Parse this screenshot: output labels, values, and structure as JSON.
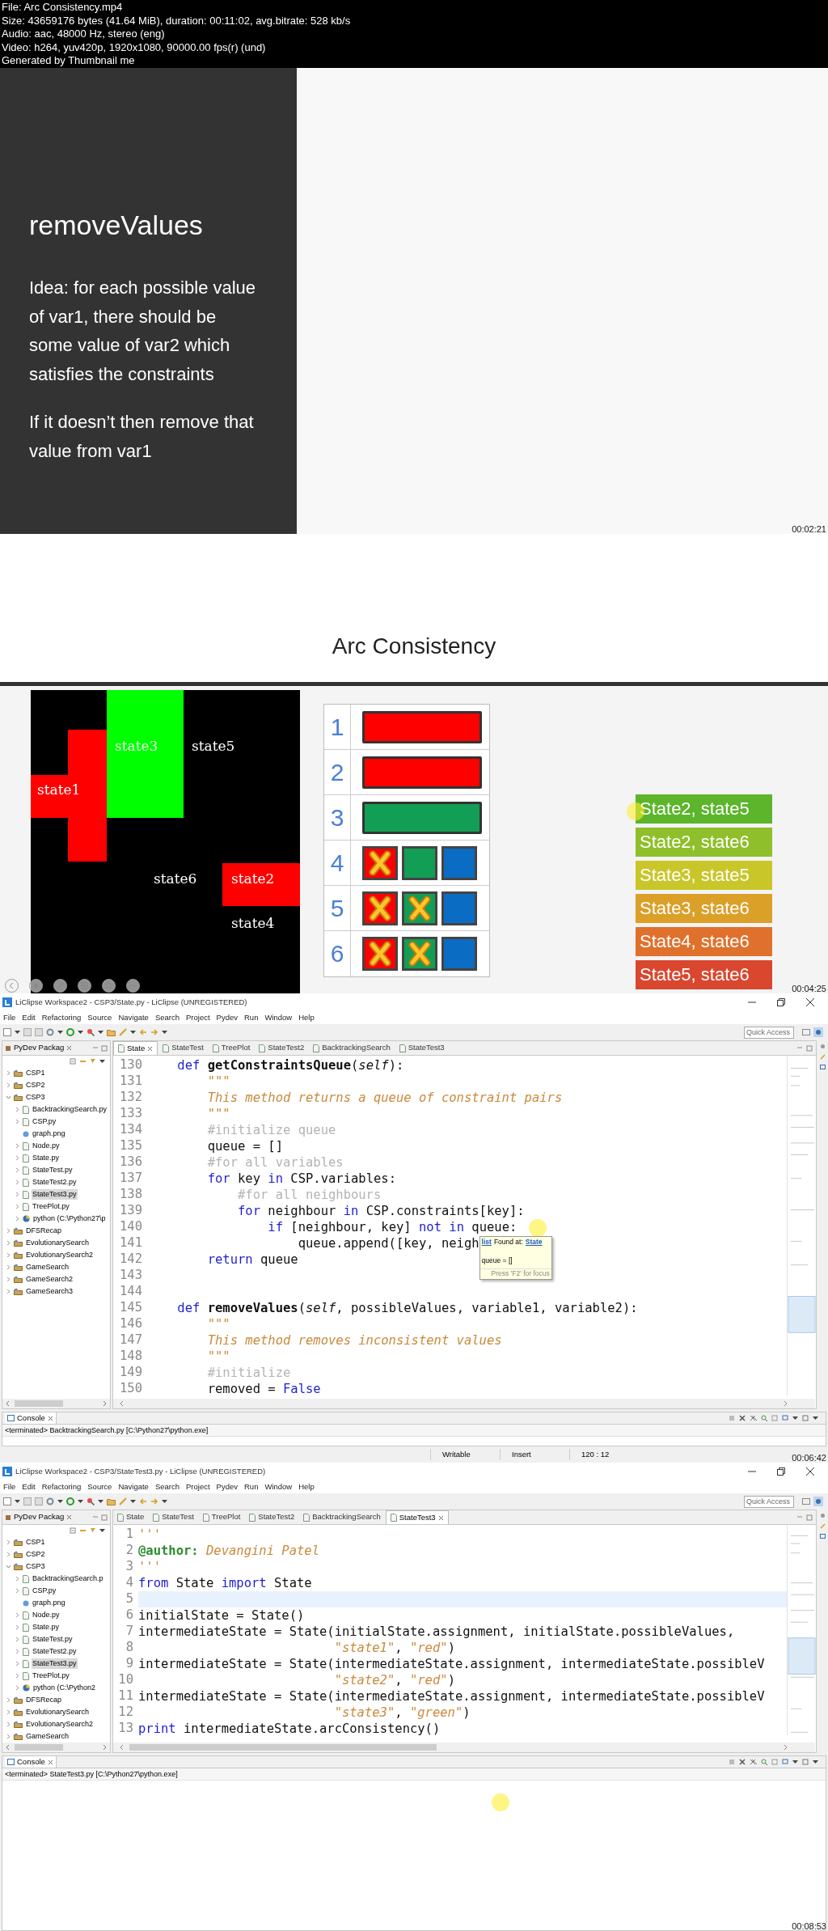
{
  "file_info": [
    "File: Arc Consistency.mp4",
    "Size: 43659176 bytes (41.64 MiB), duration: 00:11:02, avg.bitrate: 528 kb/s",
    "Audio: aac, 48000 Hz, stereo (eng)",
    "Video: h264, yuv420p, 1920x1080, 90000.00 fps(r) (und)",
    "Generated by Thumbnail me"
  ],
  "frames": [
    {
      "kind": "text_slide",
      "title": "removeValues",
      "paragraphs": [
        "Idea: for each possible value of var1, there should be some value of var2 which satisfies the constraints",
        "If it doesn’t then remove that value from var1"
      ],
      "timestamp": "00:02:21"
    },
    {
      "kind": "diagram_slide",
      "title": "Arc Consistency",
      "map": [
        {
          "label": "state3",
          "color": "#00ff00"
        },
        {
          "label": "state5"
        },
        {
          "label": "state1",
          "color": "#ff0000"
        },
        {
          "label": "state6"
        },
        {
          "label": "state2",
          "color": "#ff0000"
        },
        {
          "label": "state4"
        }
      ],
      "table": [
        {
          "number": "1",
          "kind": "bar",
          "color": "#ff0000"
        },
        {
          "number": "2",
          "kind": "bar",
          "color": "#ff0000"
        },
        {
          "number": "3",
          "kind": "bar",
          "color": "#139e55"
        },
        {
          "number": "4",
          "kind": "squares",
          "squares": [
            {
              "color": "#ff0000",
              "crossed": true
            },
            {
              "color": "#139e55",
              "crossed": false
            },
            {
              "color": "#0b6cc4",
              "crossed": false
            }
          ]
        },
        {
          "number": "5",
          "kind": "squares",
          "squares": [
            {
              "color": "#ff0000",
              "crossed": true
            },
            {
              "color": "#139e55",
              "crossed": true
            },
            {
              "color": "#0b6cc4",
              "crossed": false
            }
          ]
        },
        {
          "number": "6",
          "kind": "squares",
          "squares": [
            {
              "color": "#ff0000",
              "crossed": true
            },
            {
              "color": "#139e55",
              "crossed": true
            },
            {
              "color": "#0b6cc4",
              "crossed": false
            }
          ]
        }
      ],
      "pairs": [
        {
          "text": "State2, state5",
          "color": "#5cb52a"
        },
        {
          "text": "State2, state6",
          "color": "#8fbf2a"
        },
        {
          "text": "State3, state5",
          "color": "#c9c62a"
        },
        {
          "text": "State3, state6",
          "color": "#dba028"
        },
        {
          "text": "State4, state6",
          "color": "#e0712c"
        },
        {
          "text": "State5, state6",
          "color": "#d9472f"
        }
      ],
      "timestamp": "00:04:25"
    },
    {
      "kind": "ide",
      "title": "LiClipse Workspace2 - CSP3/State.py - LiClipse (UNREGISTERED)",
      "menu": [
        "File",
        "Edit",
        "Refactoring",
        "Source",
        "Navigate",
        "Search",
        "Project",
        "Pydev",
        "Run",
        "Window",
        "Help"
      ],
      "quick_access": {
        "placeholder": "Quick Access"
      },
      "explorer": {
        "title": "PyDev Packag",
        "tree": [
          {
            "label": "CSP1",
            "kind": "project",
            "expanded": false,
            "selected": false
          },
          {
            "label": "CSP2",
            "kind": "project",
            "expanded": false,
            "selected": false
          },
          {
            "label": "CSP3",
            "kind": "project",
            "expanded": true,
            "selected": false,
            "children": [
              {
                "label": "BacktrackingSearch.py",
                "kind": "file",
                "expanded": false,
                "selected": false
              },
              {
                "label": "CSP.py",
                "kind": "file",
                "expanded": false,
                "selected": false
              },
              {
                "label": "graph.png",
                "kind": "image",
                "selected": false
              },
              {
                "label": "Node.py",
                "kind": "file",
                "expanded": false,
                "selected": false
              },
              {
                "label": "State.py",
                "kind": "file",
                "expanded": false,
                "selected": false
              },
              {
                "label": "StateTest.py",
                "kind": "file",
                "expanded": false,
                "selected": false
              },
              {
                "label": "StateTest2.py",
                "kind": "file",
                "expanded": false,
                "selected": false
              },
              {
                "label": "StateTest3.py",
                "kind": "file",
                "expanded": false,
                "selected": true
              },
              {
                "label": "TreePlot.py",
                "kind": "file",
                "expanded": false,
                "selected": false
              },
              {
                "label": "python (C:\\Python27\\p",
                "kind": "interpreter",
                "expanded": false,
                "selected": false
              }
            ]
          },
          {
            "label": "DFSRecap",
            "kind": "project",
            "expanded": false,
            "selected": false
          },
          {
            "label": "EvolutionarySearch",
            "kind": "project",
            "expanded": false,
            "selected": false
          },
          {
            "label": "EvolutionarySearch2",
            "kind": "project",
            "expanded": false,
            "selected": false
          },
          {
            "label": "GameSearch",
            "kind": "project",
            "expanded": false,
            "selected": false
          },
          {
            "label": "GameSearch2",
            "kind": "project",
            "expanded": false,
            "selected": false
          },
          {
            "label": "GameSearch3",
            "kind": "project",
            "expanded": false,
            "selected": false
          }
        ]
      },
      "tabs": [
        {
          "label": "State",
          "selected": true
        },
        {
          "label": "StateTest",
          "selected": false
        },
        {
          "label": "TreePlot",
          "selected": false
        },
        {
          "label": "StateTest2",
          "selected": false
        },
        {
          "label": "BacktrackingSearch",
          "selected": false
        },
        {
          "label": "StateTest3",
          "selected": false
        }
      ],
      "code": [
        {
          "number": "130",
          "segments": [
            {
              "text": "    def",
              "kind": "keyword"
            },
            {
              "text": " getConstraintsQueue",
              "kind": "name"
            },
            {
              "text": "(",
              "kind": "plain"
            },
            {
              "text": "self",
              "kind": "self"
            },
            {
              "text": "):",
              "kind": "plain"
            }
          ]
        },
        {
          "number": "131",
          "segments": [
            {
              "text": "        \"\"\"",
              "kind": "doc"
            }
          ]
        },
        {
          "number": "132",
          "segments": [
            {
              "text": "        This method returns a queue of constraint pairs",
              "kind": "doc"
            }
          ]
        },
        {
          "number": "133",
          "segments": [
            {
              "text": "        \"\"\"",
              "kind": "doc"
            }
          ]
        },
        {
          "number": "134",
          "segments": [
            {
              "text": "        #initialize queue",
              "kind": "comment"
            }
          ]
        },
        {
          "number": "135",
          "segments": [
            {
              "text": "        queue = []",
              "kind": "plain"
            }
          ]
        },
        {
          "number": "136",
          "segments": [
            {
              "text": "        #for all variables",
              "kind": "comment"
            }
          ]
        },
        {
          "number": "137",
          "segments": [
            {
              "text": "        for",
              "kind": "keyword"
            },
            {
              "text": " key ",
              "kind": "plain"
            },
            {
              "text": "in",
              "kind": "keyword"
            },
            {
              "text": " CSP.variables:",
              "kind": "plain"
            }
          ]
        },
        {
          "number": "138",
          "segments": [
            {
              "text": "            #for all neighbours",
              "kind": "comment"
            }
          ]
        },
        {
          "number": "139",
          "segments": [
            {
              "text": "            for",
              "kind": "keyword"
            },
            {
              "text": " neighbour ",
              "kind": "plain"
            },
            {
              "text": "in",
              "kind": "keyword"
            },
            {
              "text": " CSP.constraints[key]:",
              "kind": "plain"
            }
          ]
        },
        {
          "number": "140",
          "segments": [
            {
              "text": "                if",
              "kind": "keyword"
            },
            {
              "text": " [neighbour, key] ",
              "kind": "plain"
            },
            {
              "text": "not in",
              "kind": "keyword"
            },
            {
              "text": " queue:",
              "kind": "plain"
            }
          ]
        },
        {
          "number": "141",
          "segments": [
            {
              "text": "                    queue.append([key, neigh",
              "kind": "plain"
            }
          ],
          "tooltip": {
            "type_link": "list",
            "label": "Found at:",
            "location_link": "State",
            "code": "queue = []",
            "hint": "Press 'F2' for focus"
          }
        },
        {
          "number": "142",
          "segments": [
            {
              "text": "        return",
              "kind": "keyword"
            },
            {
              "text": " queue",
              "kind": "plain"
            }
          ]
        },
        {
          "number": "143"
        },
        {
          "number": "144"
        },
        {
          "number": "145",
          "segments": [
            {
              "text": "    def",
              "kind": "keyword"
            },
            {
              "text": " removeValues",
              "kind": "name"
            },
            {
              "text": "(",
              "kind": "plain"
            },
            {
              "text": "self",
              "kind": "self"
            },
            {
              "text": ", possibleValues, variable1, variable2):",
              "kind": "plain"
            }
          ]
        },
        {
          "number": "146",
          "segments": [
            {
              "text": "        \"\"\"",
              "kind": "doc"
            }
          ]
        },
        {
          "number": "147",
          "segments": [
            {
              "text": "        This method removes inconsistent values",
              "kind": "doc"
            }
          ]
        },
        {
          "number": "148",
          "segments": [
            {
              "text": "        \"\"\"",
              "kind": "doc"
            }
          ]
        },
        {
          "number": "149",
          "segments": [
            {
              "text": "        #initialize",
              "kind": "comment"
            }
          ]
        },
        {
          "number": "150",
          "segments": [
            {
              "text": "        removed = ",
              "kind": "plain"
            },
            {
              "text": "False",
              "kind": "keyword"
            }
          ]
        }
      ],
      "console": {
        "title": "Console",
        "status": "<terminated> BacktrackingSearch.py [C:\\Python27\\python.exe]"
      },
      "status_bar": [
        "Writable",
        "Insert",
        "120 : 12"
      ],
      "timestamp": "00:06:42"
    },
    {
      "kind": "ide",
      "title": "LiClipse Workspace2 - CSP3/StateTest3.py - LiClipse (UNREGISTERED)",
      "menu": [
        "File",
        "Edit",
        "Refactoring",
        "Source",
        "Navigate",
        "Search",
        "Project",
        "Pydev",
        "Run",
        "Window",
        "Help"
      ],
      "quick_access": {
        "placeholder": "Quick Access"
      },
      "explorer": {
        "title": "PyDev Packag",
        "tree": [
          {
            "label": "CSP1",
            "kind": "project",
            "expanded": false,
            "selected": false
          },
          {
            "label": "CSP2",
            "kind": "project",
            "expanded": false,
            "selected": false
          },
          {
            "label": "CSP3",
            "kind": "project",
            "expanded": true,
            "selected": false,
            "children": [
              {
                "label": "BacktrackingSearch.p",
                "kind": "file",
                "expanded": false,
                "selected": false
              },
              {
                "label": "CSP.py",
                "kind": "file",
                "expanded": false,
                "selected": false
              },
              {
                "label": "graph.png",
                "kind": "image",
                "selected": false
              },
              {
                "label": "Node.py",
                "kind": "file",
                "expanded": false,
                "selected": false
              },
              {
                "label": "State.py",
                "kind": "file",
                "expanded": false,
                "selected": false
              },
              {
                "label": "StateTest.py",
                "kind": "file",
                "expanded": false,
                "selected": false
              },
              {
                "label": "StateTest2.py",
                "kind": "file",
                "expanded": false,
                "selected": false
              },
              {
                "label": "StateTest3.py",
                "kind": "file",
                "expanded": false,
                "selected": true
              },
              {
                "label": "TreePlot.py",
                "kind": "file",
                "expanded": false,
                "selected": false
              },
              {
                "label": "python (C:\\Python2",
                "kind": "interpreter",
                "expanded": false,
                "selected": false
              }
            ]
          },
          {
            "label": "DFSRecap",
            "kind": "project",
            "expanded": false,
            "selected": false
          },
          {
            "label": "EvolutionarySearch",
            "kind": "project",
            "expanded": false,
            "selected": false
          },
          {
            "label": "EvolutionarySearch2",
            "kind": "project",
            "expanded": false,
            "selected": false
          },
          {
            "label": "GameSearch",
            "kind": "project",
            "expanded": false,
            "selected": false
          }
        ]
      },
      "tabs": [
        {
          "label": "State",
          "selected": false
        },
        {
          "label": "StateTest",
          "selected": false
        },
        {
          "label": "TreePlot",
          "selected": false
        },
        {
          "label": "StateTest2",
          "selected": false
        },
        {
          "label": "BacktrackingSearch",
          "selected": false
        },
        {
          "label": "StateTest3",
          "selected": true
        }
      ],
      "code": [
        {
          "number": "1",
          "segments": [
            {
              "text": "'''",
              "kind": "string"
            }
          ]
        },
        {
          "number": "2",
          "segments": [
            {
              "text": "@author:",
              "kind": "decorator"
            },
            {
              "text": " Devangini Patel",
              "kind": "string"
            }
          ]
        },
        {
          "number": "3",
          "segments": [
            {
              "text": "'''",
              "kind": "string"
            }
          ]
        },
        {
          "number": "4",
          "segments": [
            {
              "text": "from",
              "kind": "keyword"
            },
            {
              "text": " State ",
              "kind": "plain"
            },
            {
              "text": "import",
              "kind": "keyword"
            },
            {
              "text": " State",
              "kind": "plain"
            }
          ]
        },
        {
          "number": "5",
          "highlighted": true
        },
        {
          "number": "6",
          "segments": [
            {
              "text": "initialState = State()",
              "kind": "plain"
            }
          ]
        },
        {
          "number": "7",
          "segments": [
            {
              "text": "intermediateState = State(initialState.assignment, initialState.possibleValues,",
              "kind": "plain"
            }
          ]
        },
        {
          "number": "8",
          "segments": [
            {
              "text": "                          \"state1\"",
              "kind": "string"
            },
            {
              "text": ", ",
              "kind": "plain"
            },
            {
              "text": "\"red\"",
              "kind": "string"
            },
            {
              "text": ")",
              "kind": "plain"
            }
          ]
        },
        {
          "number": "9",
          "segments": [
            {
              "text": "intermediateState = State(intermediateState.assignment, intermediateState.possibleV",
              "kind": "plain"
            }
          ]
        },
        {
          "number": "10",
          "segments": [
            {
              "text": "                          \"state2\"",
              "kind": "string"
            },
            {
              "text": ", ",
              "kind": "plain"
            },
            {
              "text": "\"red\"",
              "kind": "string"
            },
            {
              "text": ")",
              "kind": "plain"
            }
          ]
        },
        {
          "number": "11",
          "segments": [
            {
              "text": "intermediateState = State(intermediateState.assignment, intermediateState.possibleV",
              "kind": "plain"
            }
          ]
        },
        {
          "number": "12",
          "segments": [
            {
              "text": "                          \"state3\"",
              "kind": "string"
            },
            {
              "text": ", ",
              "kind": "plain"
            },
            {
              "text": "\"green\"",
              "kind": "string"
            },
            {
              "text": ")",
              "kind": "plain"
            }
          ]
        },
        {
          "number": "13",
          "segments": [
            {
              "text": "print",
              "kind": "keyword"
            },
            {
              "text": " intermediateState.arcConsistency()",
              "kind": "plain"
            }
          ]
        }
      ],
      "console": {
        "title": "Console",
        "status": "<terminated> StateTest3.py [C:\\Python27\\python.exe]"
      },
      "timestamp": "00:08:53"
    }
  ]
}
